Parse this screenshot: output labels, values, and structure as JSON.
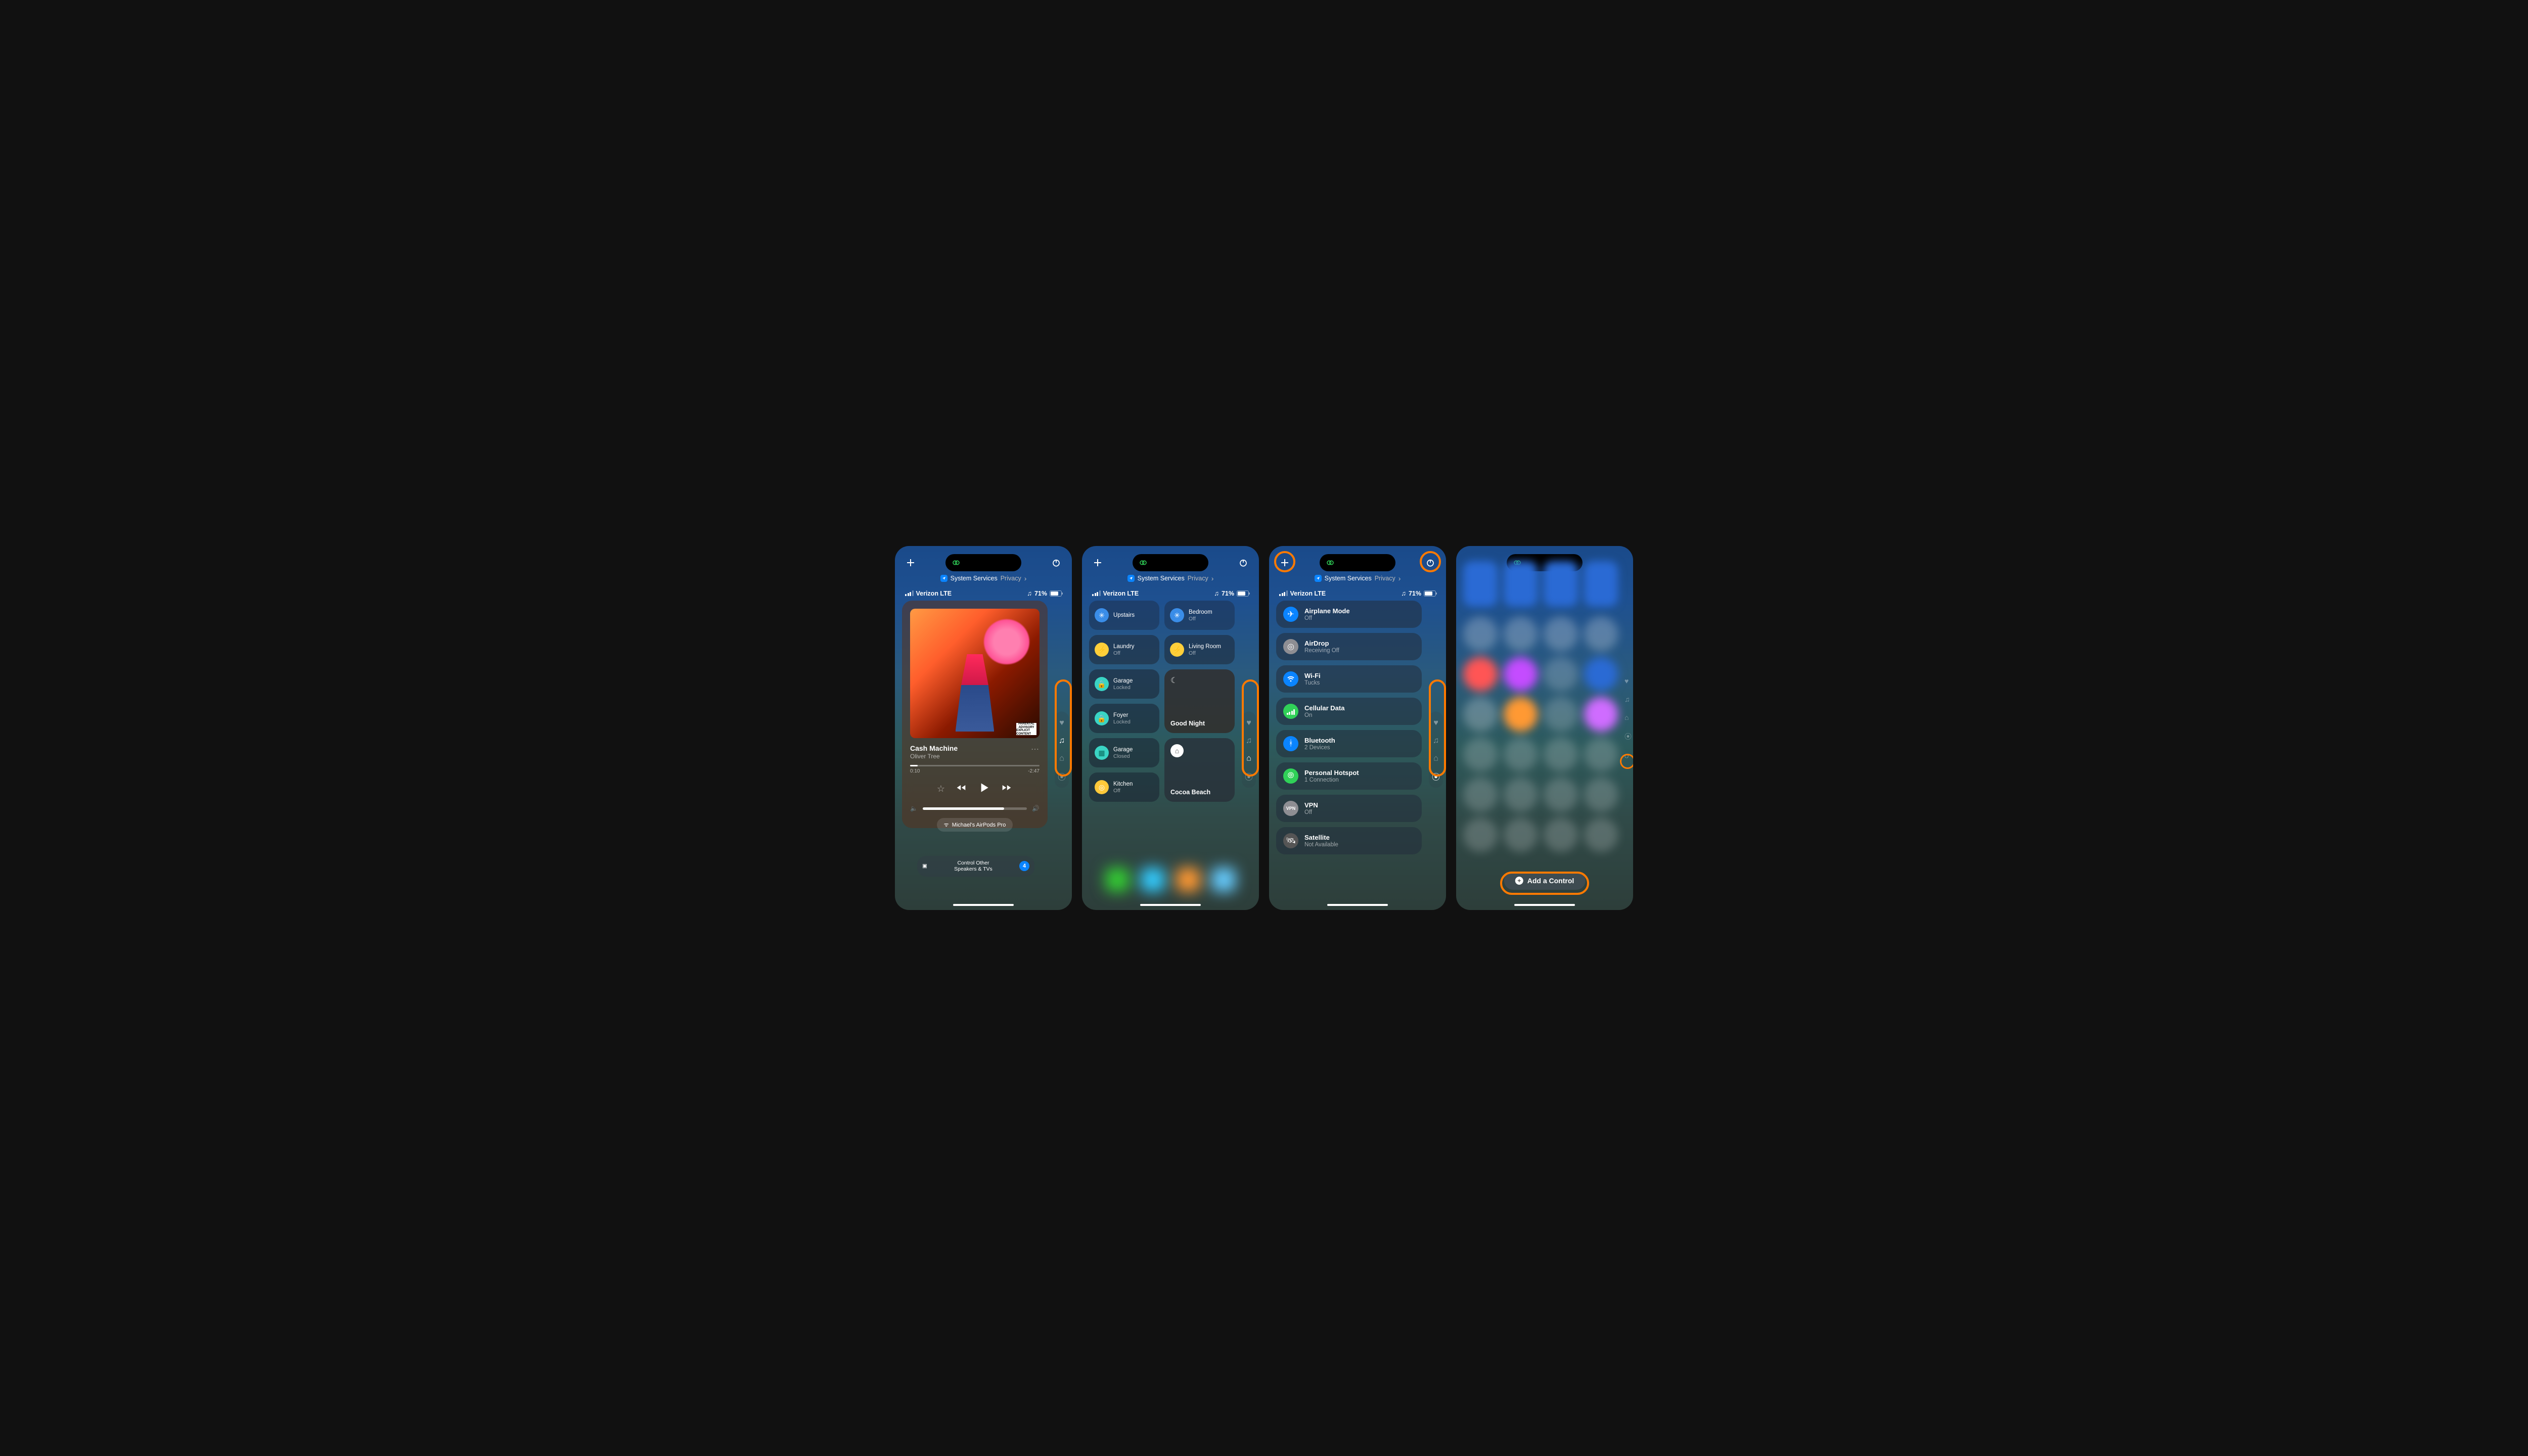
{
  "breadcrumb": {
    "main": "System Services",
    "secondary": "Privacy"
  },
  "status": {
    "carrier": "Verizon LTE",
    "battery": "71%"
  },
  "sidenav": {
    "items": [
      "favorites",
      "music",
      "home",
      "connectivity"
    ]
  },
  "panel1": {
    "track": "Cash Machine",
    "artist": "Oliver Tree",
    "elapsed": "0:10",
    "remaining": "-2:47",
    "airpods": "Michael's AirPods Pro",
    "control_other": "Control Other\nSpeakers & TVs",
    "control_other_badge": "4",
    "advisory_top": "PARENTAL",
    "advisory_mid": "ADVISORY",
    "advisory_bot": "EXPLICIT CONTENT"
  },
  "panel2": {
    "tiles": [
      {
        "name": "Upstairs",
        "status": "",
        "icon": "fan"
      },
      {
        "name": "Bedroom",
        "status": "Off",
        "icon": "fan"
      },
      {
        "name": "Laundry",
        "status": "Off",
        "icon": "plug"
      },
      {
        "name": "Living Room",
        "status": "Off",
        "icon": "plug"
      },
      {
        "name": "Garage",
        "status": "Locked",
        "icon": "lock"
      },
      {
        "name": "Foyer",
        "status": "Locked",
        "icon": "lock"
      },
      {
        "name": "Garage",
        "status": "Closed",
        "icon": "garage"
      },
      {
        "name": "Kitchen",
        "status": "Off",
        "icon": "nest"
      }
    ],
    "scenes": [
      {
        "name": "Good Night",
        "icon": "moon"
      },
      {
        "name": "Cocoa Beach",
        "icon": "home"
      }
    ]
  },
  "panel3": {
    "items": [
      {
        "name": "Airplane Mode",
        "status": "Off",
        "color": "#0a84ff",
        "icon": "airplane"
      },
      {
        "name": "AirDrop",
        "status": "Receiving Off",
        "color": "#8e8e93",
        "icon": "airdrop"
      },
      {
        "name": "Wi-Fi",
        "status": "Tucks",
        "color": "#0a84ff",
        "icon": "wifi"
      },
      {
        "name": "Cellular Data",
        "status": "On",
        "color": "#30d158",
        "icon": "cellular"
      },
      {
        "name": "Bluetooth",
        "status": "2 Devices",
        "color": "#0a84ff",
        "icon": "bluetooth"
      },
      {
        "name": "Personal Hotspot",
        "status": "1 Connection",
        "color": "#30d158",
        "icon": "hotspot"
      },
      {
        "name": "VPN",
        "status": "Off",
        "color": "#8e8e93",
        "icon": "vpn"
      },
      {
        "name": "Satellite",
        "status": "Not Available",
        "color": "#555",
        "icon": "satellite"
      }
    ]
  },
  "panel4": {
    "add_label": "Add a Control"
  }
}
